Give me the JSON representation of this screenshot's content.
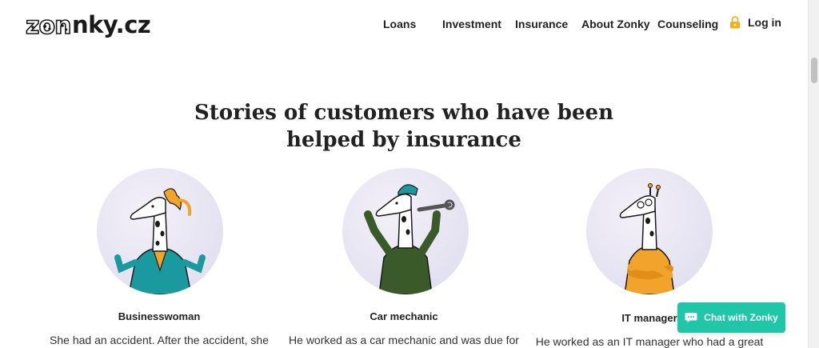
{
  "brand": {
    "logo_prefix": "zon",
    "logo_text": "nky.cz"
  },
  "nav": {
    "items": [
      {
        "label": "Loans"
      },
      {
        "label": "Investment"
      },
      {
        "label": "Insurance"
      },
      {
        "label": "About Zonky"
      },
      {
        "label": "Counseling"
      }
    ],
    "login_label": "Log in",
    "login_icon": "lock-icon"
  },
  "section": {
    "title": "Stories of customers who have been helped by insurance"
  },
  "stories": [
    {
      "name": "Businesswoman",
      "text": "She had an accident. After the accident, she",
      "illustration": "giraffe-businesswoman"
    },
    {
      "name": "Car mechanic",
      "text": "He worked as a car mechanic and was due for",
      "illustration": "giraffe-car-mechanic"
    },
    {
      "name": "IT manager",
      "text": "He worked as an IT manager who had a great",
      "illustration": "giraffe-it-manager"
    }
  ],
  "chat": {
    "label": "Chat with Zonky",
    "icon": "chat-bubble-icon"
  },
  "colors": {
    "accent": "#1fc7a8",
    "lock": "#f2b21a",
    "teal_shirt": "#1a9a9f",
    "mechanic_green": "#3a5a2a",
    "it_orange": "#f2a32a"
  }
}
